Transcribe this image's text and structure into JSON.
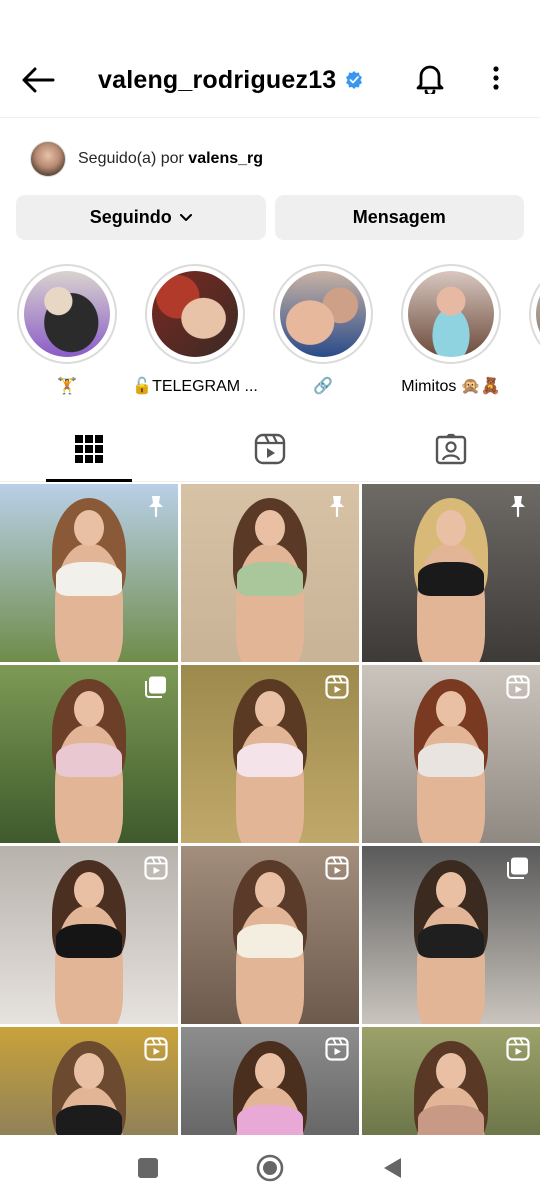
{
  "header": {
    "username": "valeng_rodriguez13",
    "verified_color": "#3897f0"
  },
  "followed_by": {
    "prefix": "Seguido(a) por",
    "username": "valens_rg"
  },
  "actions": {
    "following_label": "Seguindo",
    "message_label": "Mensagem"
  },
  "highlights": [
    {
      "label": "🏋️",
      "colors": [
        "#2b2b2b",
        "#8a5cc8",
        "#e9d7c6"
      ]
    },
    {
      "label": "🔓TELEGRAM ...",
      "colors": [
        "#b23a2b",
        "#e9c3a8",
        "#f0f0f0"
      ]
    },
    {
      "label": "🔗",
      "colors": [
        "#e7b89c",
        "#2a4b8a",
        "#cfa088"
      ]
    },
    {
      "label": "Mimitos 🙊🧸",
      "colors": [
        "#8fd3e0",
        "#e8b9a2",
        "#6b4a3a"
      ]
    }
  ],
  "tabs": [
    {
      "name": "grid",
      "icon": "grid-icon",
      "active": true
    },
    {
      "name": "reels",
      "icon": "reels-icon",
      "active": false
    },
    {
      "name": "tagged",
      "icon": "tagged-icon",
      "active": false
    }
  ],
  "posts": [
    {
      "badge": "pin-icon",
      "bg": [
        "#b9d0e8",
        "#6f8c4a"
      ],
      "outfit": "#f2f0ea",
      "hair": "#8a5a38"
    },
    {
      "badge": "pin-icon",
      "bg": [
        "#d8c2a6",
        "#c9b397"
      ],
      "outfit": "#a9c79b",
      "hair": "#5a3a26"
    },
    {
      "badge": "pin-icon",
      "bg": [
        "#6e6a66",
        "#3d3a38"
      ],
      "outfit": "#1a1a1a",
      "hair": "#d9b978"
    },
    {
      "badge": "carousel-icon",
      "bg": [
        "#7d9a55",
        "#3f5a2c"
      ],
      "outfit": "#e9c8d2",
      "hair": "#6b3f28"
    },
    {
      "badge": "reel-icon",
      "bg": [
        "#9c8a4c",
        "#c0a86a"
      ],
      "outfit": "#f4e4ea",
      "hair": "#5b3a24"
    },
    {
      "badge": "reel-icon",
      "bg": [
        "#cbc4bd",
        "#8f8982"
      ],
      "outfit": "#e9e4df",
      "hair": "#7a3a22"
    },
    {
      "badge": "reel-icon",
      "bg": [
        "#b8b2ac",
        "#e6e2de"
      ],
      "outfit": "#151515",
      "hair": "#4b3022"
    },
    {
      "badge": "reel-icon",
      "bg": [
        "#a38e7c",
        "#6c5a4d"
      ],
      "outfit": "#f4eee0",
      "hair": "#5a3a28"
    },
    {
      "badge": "carousel-icon",
      "bg": [
        "#5a5a5a",
        "#c9c4bd"
      ],
      "outfit": "#1f1f1f",
      "hair": "#3b2a20"
    },
    {
      "badge": "reel-icon",
      "bg": [
        "#c9a23a",
        "#6c6c6c"
      ],
      "outfit": "#1c1c1c",
      "hair": "#6b4a30"
    },
    {
      "badge": "reel-icon",
      "bg": [
        "#8d8d8d",
        "#4e4e4e"
      ],
      "outfit": "#e9a9d6",
      "hair": "#4a2e1e"
    },
    {
      "badge": "reel-icon",
      "bg": [
        "#9da26a",
        "#4d5a34"
      ],
      "outfit": "#c89a86",
      "hair": "#5a3826"
    }
  ],
  "navbar": {
    "recent_icon": "square-icon",
    "home_icon": "circle-icon",
    "back_icon": "triangle-back-icon"
  }
}
